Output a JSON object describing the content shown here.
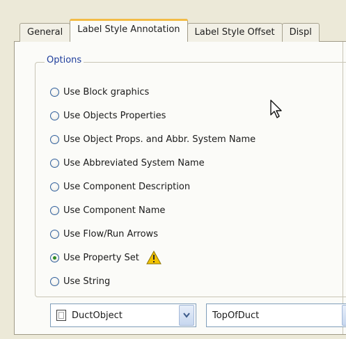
{
  "tabs": [
    {
      "label": "General",
      "active": false
    },
    {
      "label": "Label Style Annotation",
      "active": true
    },
    {
      "label": "Label Style Offset",
      "active": false
    },
    {
      "label": "Displ",
      "active": false
    }
  ],
  "group": {
    "title": "Options",
    "options": [
      {
        "label": "Use Block graphics",
        "checked": false
      },
      {
        "label": "Use Objects Properties",
        "checked": false
      },
      {
        "label": "Use Object Props. and Abbr. System Name",
        "checked": false
      },
      {
        "label": "Use Abbreviated System Name",
        "checked": false
      },
      {
        "label": "Use Component Description",
        "checked": false
      },
      {
        "label": "Use Component Name",
        "checked": false
      },
      {
        "label": "Use Flow/Run Arrows",
        "checked": false
      },
      {
        "label": "Use Property Set",
        "checked": true,
        "icon": "warning-icon"
      },
      {
        "label": "Use String",
        "checked": false
      }
    ]
  },
  "combos": [
    {
      "value": "DuctObject",
      "icon": "property-set-icon"
    },
    {
      "value": "TopOfDuct"
    }
  ],
  "colors": {
    "active_tab_accent": "#f3bc46",
    "group_title": "#1e3d9b",
    "selected_radio": "#2f8a24",
    "warning": "#f2c200"
  }
}
